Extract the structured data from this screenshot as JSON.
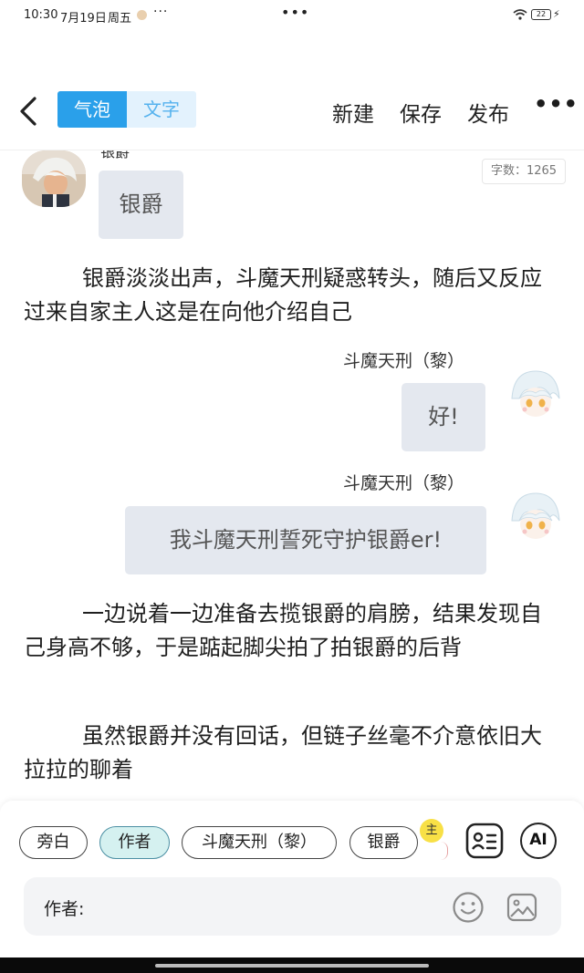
{
  "status_bar": {
    "time": "10:30",
    "date": "7月19日",
    "weekday": "周五",
    "more": "···",
    "center_dots": "•••",
    "battery": "22",
    "charge_symbol": "⚡"
  },
  "toolbar": {
    "tabs": [
      {
        "label": "气泡",
        "active": true
      },
      {
        "label": "文字",
        "active": false
      }
    ],
    "new_label": "新建",
    "save_label": "保存",
    "publish_label": "发布",
    "more_label": "•••"
  },
  "meta": {
    "word_count": "字数：1265"
  },
  "messages": {
    "m1": {
      "speaker": "银爵",
      "text": "银爵"
    },
    "p1": "银爵淡淡出声，斗魔天刑疑惑转头，随后又反应过来自家主人这是在向他介绍自己",
    "m2": {
      "speaker": "斗魔天刑（黎）",
      "text": "好!"
    },
    "m3": {
      "speaker": "斗魔天刑（黎）",
      "text": "我斗魔天刑誓死守护银爵er!"
    },
    "p2": "一边说着一边准备去揽银爵的肩膀，结果发现自己身高不够，于是踮起脚尖拍了拍银爵的后背",
    "p3": "虽然银爵并没有回话，但链子丝毫不介意依旧大拉拉的聊着"
  },
  "roles": {
    "narration": "旁白",
    "author": "作者",
    "role1": "斗魔天刑（黎）",
    "role2": "银爵",
    "main_badge": "主"
  },
  "input": {
    "label": "作者:",
    "ai_label": "AI"
  },
  "colors": {
    "accent": "#2aa0ea",
    "accent_light": "#e3f2fd",
    "bubble": "#e4e8ef",
    "author_chip": "#d5f1f0"
  }
}
